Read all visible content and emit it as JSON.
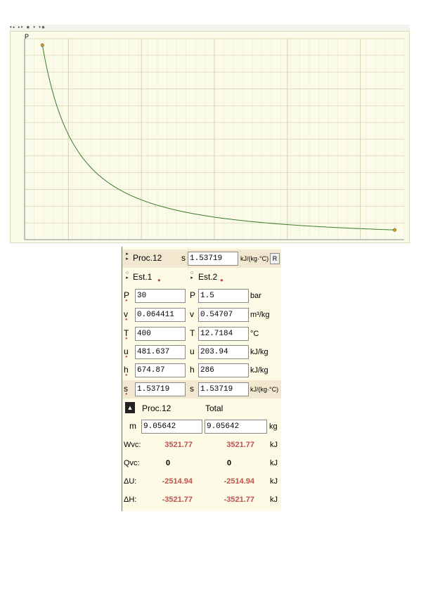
{
  "toolbar": {
    "items": [
      "▾ ◂",
      "▸ ▾",
      "◉",
      "▾",
      "▾ ◉"
    ]
  },
  "chart_data": {
    "type": "line",
    "title": "",
    "ylabel": "P",
    "xlabel": "",
    "grid": true,
    "series": [
      {
        "points": [
          [
            0.064411,
            30
          ],
          [
            0.08,
            24.2
          ],
          [
            0.1,
            19.4
          ],
          [
            0.13,
            14.9
          ],
          [
            0.16,
            12.1
          ],
          [
            0.2,
            9.7
          ],
          [
            0.25,
            7.8
          ],
          [
            0.3,
            6.5
          ],
          [
            0.35,
            5.6
          ],
          [
            0.4,
            4.9
          ],
          [
            0.45,
            4.3
          ],
          [
            0.5,
            3.9
          ],
          [
            0.54707,
            1.5
          ]
        ]
      }
    ],
    "state_markers": [
      {
        "x": 0.064411,
        "y": 30
      },
      {
        "x": 0.54707,
        "y": 1.5
      }
    ],
    "colors": {
      "curve": "#3a7a2a",
      "marker": "#d4a017",
      "grid_major": "#d0d0a8",
      "grid_minor": "#e8e8cc"
    }
  },
  "process": {
    "name": "Proc.12",
    "prop_label": "s",
    "prop_value": "1.53719",
    "prop_unit": "kJ/(kg·°C)",
    "btn": "R"
  },
  "states": {
    "st1": "Est.1",
    "st2": "Est.2",
    "rows": [
      {
        "k": "P",
        "v1": "30",
        "v2": "1.5",
        "unit": "bar"
      },
      {
        "k": "v",
        "v1": "0.064411",
        "v2": "0.54707",
        "unit": "m³/kg"
      },
      {
        "k": "T",
        "v1": "400",
        "v2": "12.7184",
        "unit": "°C"
      },
      {
        "k": "u",
        "v1": "481.637",
        "v2": "203.94",
        "unit": "kJ/kg"
      },
      {
        "k": "h",
        "v1": "674.87",
        "v2": "286",
        "unit": "kJ/kg"
      },
      {
        "k": "s",
        "v1": "1.53719",
        "v2": "1.53719",
        "unit": "kJ/(kg·°C)"
      }
    ]
  },
  "totals": {
    "col1": "Proc.12",
    "col2": "Total",
    "m": {
      "label": "m",
      "v1": "9.05642",
      "v2": "9.05642",
      "unit": "kg"
    },
    "rows": [
      {
        "label": "Wvc:",
        "v1": "3521.77",
        "v2": "3521.77",
        "unit": "kJ",
        "red": true
      },
      {
        "label": "Qvc:",
        "v1": "0",
        "v2": "0",
        "unit": "kJ",
        "red": false
      },
      {
        "label": "ΔU:",
        "v1": "-2514.94",
        "v2": "-2514.94",
        "unit": "kJ",
        "red": true
      },
      {
        "label": "ΔH:",
        "v1": "-3521.77",
        "v2": "-3521.77",
        "unit": "kJ",
        "red": true
      }
    ]
  }
}
